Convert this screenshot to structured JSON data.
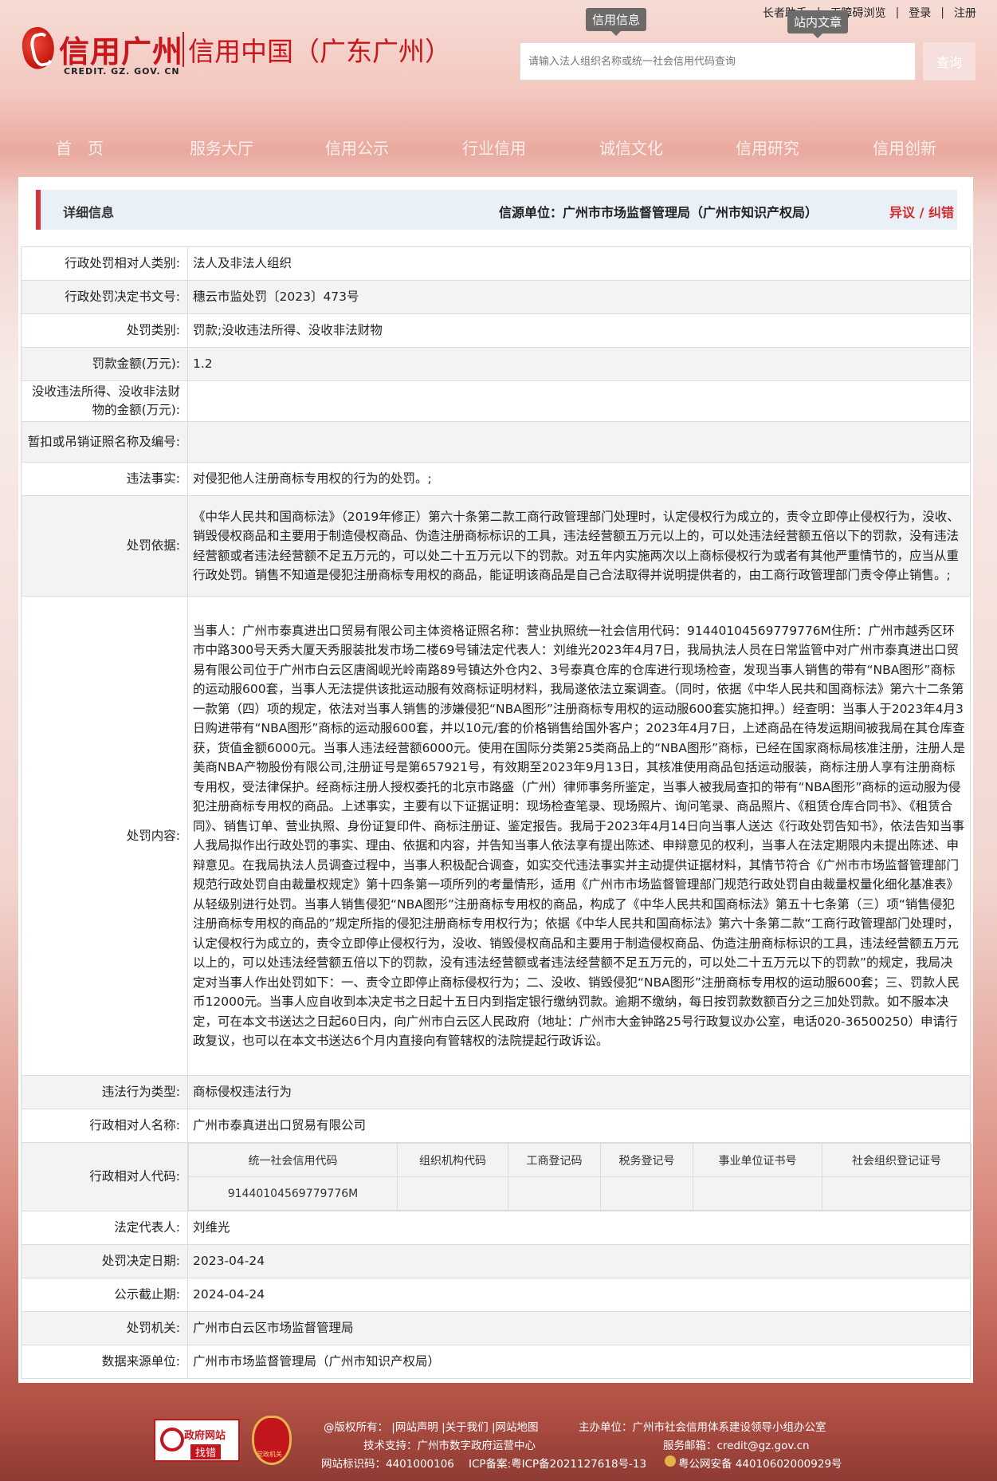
{
  "header": {
    "logo_text": "信用广州",
    "logo_en": "CREDIT. GZ. GOV. CN",
    "logo_subtitle": "信用中国（广东广州）",
    "top_links": [
      "长者助手",
      "无障碍浏览",
      "登录",
      "注册"
    ],
    "bubble_credit": "信用信息",
    "bubble_site": "站内文章",
    "search_placeholder": "请输入法人组织名称或统一社会信用代码查询",
    "search_button": "查询",
    "nav": [
      "首　页",
      "服务大厅",
      "信用公示",
      "行业信用",
      "诚信文化",
      "信用研究",
      "信用创新"
    ]
  },
  "detail": {
    "title": "详细信息",
    "source": "信源单位：广州市市场监督管理局（广州市知识产权局）",
    "objection": "异议 / 纠错",
    "rows": [
      {
        "label": "行政处罚相对人类别:",
        "value": "法人及非法人组织"
      },
      {
        "label": "行政处罚决定书文号:",
        "value": "穗云市监处罚〔2023〕473号"
      },
      {
        "label": "处罚类别:",
        "value": "罚款;没收违法所得、没收非法财物"
      },
      {
        "label": "罚款金额(万元):",
        "value": "1.2"
      },
      {
        "label": "没收违法所得、没收非法财物的金额(万元):",
        "value": ""
      },
      {
        "label": "暂扣或吊销证照名称及编号:",
        "value": ""
      },
      {
        "label": "违法事实:",
        "value": "对侵犯他人注册商标专用权的行为的处罚。;"
      },
      {
        "label": "处罚依据:",
        "value": "《中华人民共和国商标法》（2019年修正）第六十条第二款工商行政管理部门处理时，认定侵权行为成立的，责令立即停止侵权行为，没收、销毁侵权商品和主要用于制造侵权商品、伪造注册商标标识的工具，违法经营额五万元以上的，可以处违法经营额五倍以下的罚款，没有违法经营额或者违法经营额不足五万元的，可以处二十五万元以下的罚款。对五年内实施两次以上商标侵权行为或者有其他严重情节的，应当从重行政处罚。销售不知道是侵犯注册商标专用权的商品，能证明该商品是自己合法取得并说明提供者的，由工商行政管理部门责令停止销售。;"
      },
      {
        "label": "处罚内容:",
        "value": "当事人：广州市泰真进出口贸易有限公司主体资格证照名称：营业执照统一社会信用代码：91440104569779776M住所：广州市越秀区环市中路300号天秀大厦天秀服装批发市场二楼69号铺法定代表人：刘维光2023年4月7日，我局执法人员在日常监管中对广州市泰真进出口贸易有限公司位于广州市白云区唐阁岘光岭南路89号镇达外仓内2、3号泰真仓库的仓库进行现场检查，发现当事人销售的带有“NBA图形”商标的运动服600套，当事人无法提供该批运动服有效商标证明材料，我局遂依法立案调查。（同时，依据《中华人民共和国商标法》第六十二条第一款第（四）项的规定，依法对当事人销售的涉嫌侵犯“NBA图形”注册商标专用权的运动服600套实施扣押。）经查明：当事人于2023年4月3日购进带有“NBA图形”商标的运动服600套，并以10元/套的价格销售给国外客户；2023年4月7日，上述商品在待发运期间被我局在其仓库查获，货值金额6000元。当事人违法经营额6000元。使用在国际分类第25类商品上的“NBA图形”商标，已经在国家商标局核准注册，注册人是美商NBA产物股份有限公司,注册证号是第657921号，有效期至2023年9月13日，其核准使用商品包括运动服装，商标注册人享有注册商标专用权，受法律保护。经商标注册人授权委托的北京市路盛（广州）律师事务所鉴定，当事人被我局查扣的带有“NBA图形”商标的运动服为侵犯注册商标专用权的商品。上述事实，主要有以下证据证明：现场检查笔录、现场照片、询问笔录、商品照片、《租赁仓库合同书》、《租赁合同》、销售订单、营业执照、身份证复印件、商标注册证、鉴定报告。我局于2023年4月14日向当事人送达《行政处罚告知书》，依法告知当事人我局拟作出行政处罚的事实、理由、依据和内容，并告知当事人依法享有提出陈述、申辩意见的权利，当事人在法定期限内未提出陈述、申辩意见。在我局执法人员调查过程中，当事人积极配合调查，如实交代违法事实并主动提供证据材料，其情节符合《广州市市场监督管理部门规范行政处罚自由裁量权规定》第十四条第一项所列的考量情形，适用《广州市市场监督管理部门规范行政处罚自由裁量权量化细化基准表》从轻级别进行处罚。当事人销售侵犯“NBA图形”注册商标专用权的商品，构成了《中华人民共和国商标法》第五十七条第（三）项“销售侵犯注册商标专用权的商品的”规定所指的侵犯注册商标专用权行为；依据《中华人民共和国商标法》第六十条第二款“工商行政管理部门处理时，认定侵权行为成立的，责令立即停止侵权行为，没收、销毁侵权商品和主要用于制造侵权商品、伪造注册商标标识的工具，违法经营额五万元以上的，可以处违法经营额五倍以下的罚款，没有违法经营额或者违法经营额不足五万元的，可以处二十五万元以下的罚款”的规定，我局决定对当事人作出处罚如下：一、责令立即停止商标侵权行为；二、没收、销毁侵犯“NBA图形”注册商标专用权的运动服600套；三、罚款人民币12000元。当事人应自收到本决定书之日起十五日内到指定银行缴纳罚款。逾期不缴纳，每日按罚款数额百分之三加处罚款。如不服本决定，可在本文书送达之日起60日内，向广州市白云区人民政府（地址：广州市大金钟路25号行政复议办公室，电话020-36500250）申请行政复议，也可以在本文书送达6个月内直接向有管辖权的法院提起行政诉讼。"
      },
      {
        "label": "违法行为类型:",
        "value": "商标侵权违法行为"
      },
      {
        "label": "行政相对人名称:",
        "value": "广州市泰真进出口贸易有限公司"
      }
    ],
    "code_row": {
      "label": "行政相对人代码:",
      "headers": [
        "统一社会信用代码",
        "组织机构代码",
        "工商登记码",
        "税务登记号",
        "事业单位证书号",
        "社会组织登记证号"
      ],
      "values": [
        "91440104569779776M",
        "",
        "",
        "",
        "",
        ""
      ]
    },
    "rows2": [
      {
        "label": "法定代表人:",
        "value": "刘维光"
      },
      {
        "label": "处罚决定日期:",
        "value": "2023-04-24"
      },
      {
        "label": "公示截止期:",
        "value": "2024-04-24"
      },
      {
        "label": "处罚机关:",
        "value": "广州市白云区市场监督管理局"
      },
      {
        "label": "数据来源单位:",
        "value": "广州市市场监督管理局（广州市知识产权局）"
      }
    ]
  },
  "footer": {
    "badge1_top": "政府网站",
    "badge1_bottom": "找错",
    "badge2_text": "党政机关",
    "links": "@版权所有：  |网站声明 |关于我们 |网站地图",
    "sponsor": "主办单位：广州市社会信用体系建设领导小组办公室",
    "tech": "技术支持：广州市数字政府运营中心",
    "email": "服务邮箱：credit@gz.gov.cn",
    "site_code": "网站标识码：4401000106",
    "icp": "ICP备案:粤ICP备2021127618号-13",
    "police": "粤公网安备 44010602000929号"
  }
}
